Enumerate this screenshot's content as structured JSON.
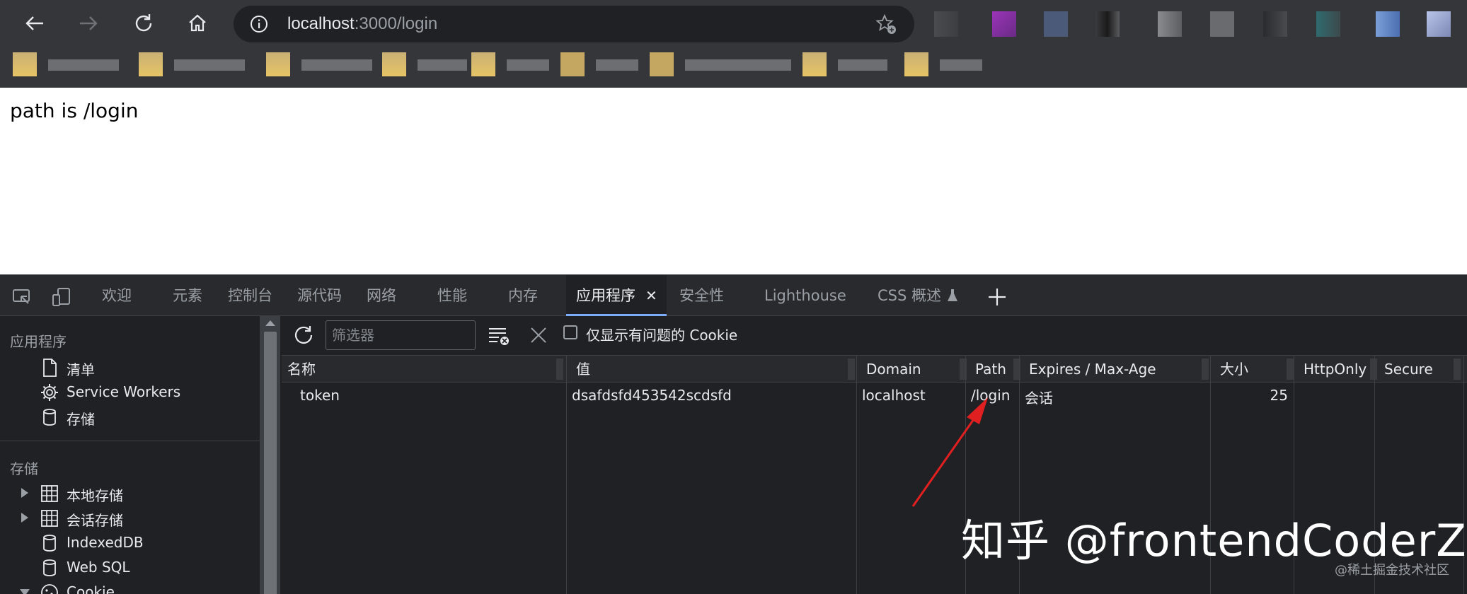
{
  "browser": {
    "url_host": "localhost",
    "url_rest": ":3000/login",
    "icons": [
      "back-icon",
      "forward-icon",
      "reload-icon",
      "home-icon",
      "info-icon",
      "favorite-add-icon"
    ]
  },
  "page": {
    "text": "path is /login"
  },
  "devtools": {
    "tabs": [
      "欢迎",
      "元素",
      "控制台",
      "源代码",
      "网络",
      "性能",
      "内存",
      "应用程序",
      "安全性",
      "Lighthouse",
      "CSS 概述"
    ],
    "active_tab": "应用程序",
    "close_glyph": "✕",
    "sidebar": {
      "app_section": "应用程序",
      "app_items": [
        "清单",
        "Service Workers",
        "存储"
      ],
      "storage_section": "存储",
      "storage_items": [
        "本地存储",
        "会话存储",
        "IndexedDB",
        "Web SQL",
        "Cookie"
      ]
    },
    "cookie_toolbar": {
      "filter_placeholder": "筛选器",
      "only_issues_label": "仅显示有问题的 Cookie"
    },
    "cookie_table": {
      "columns": [
        "名称",
        "值",
        "Domain",
        "Path",
        "Expires / Max-Age",
        "大小",
        "HttpOnly",
        "Secure"
      ],
      "rows": [
        {
          "name": "token",
          "value": "dsafdsfd453542scdsfd",
          "domain": "localhost",
          "path": "/login",
          "expires": "会话",
          "size": "25",
          "httponly": "",
          "secure": ""
        }
      ]
    }
  },
  "annotation": {
    "arrow_color": "#e02020"
  },
  "watermark": {
    "main": "知乎 @frontendCoderZ",
    "small": "@稀土掘金技术社区"
  }
}
